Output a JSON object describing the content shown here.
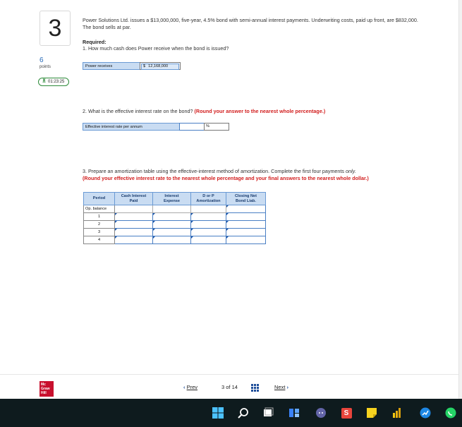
{
  "question": {
    "number": "3",
    "points_value": "6",
    "points_label": "points",
    "timer": "01:23:25",
    "text": "Power Solutions Ltd. issues a $13,000,000, five-year, 4.5% bond with semi-annual interest payments. Underwriting costs, paid up front, are $832,000. The bond sells at par.",
    "required_title": "Required:",
    "required_1": "1. How much cash does Power receive when the bond is issued?"
  },
  "part1": {
    "label": "Power receives",
    "currency": "$",
    "value": "12,168,000"
  },
  "part2": {
    "question": "2. What is the effective interest rate on the bond?",
    "instruction": "(Round your answer to the nearest whole percentage.)",
    "label": "Effective interest rate per annum",
    "value": "",
    "unit": "%"
  },
  "part3": {
    "question_a": "3. Prepare an amortization table using the effective-interest method of amortization. Complete the first four payments ",
    "question_only": "only.",
    "instruction": "(Round your effective interest rate to the nearest whole percentage and your final answers to the nearest whole dollar.)",
    "headers": {
      "period": "Period",
      "cash_interest": [
        "Cash Interest",
        "Paid"
      ],
      "interest_expense": [
        "Interest",
        "Expense"
      ],
      "amortization": [
        "D or P",
        "Amortization"
      ],
      "closing": [
        "Closing Net",
        "Bond Liab."
      ]
    },
    "rows": [
      "Op. balance",
      "1",
      "2",
      "3",
      "4"
    ]
  },
  "footer": {
    "logo_lines": [
      "Mc",
      "Graw",
      "Hill"
    ],
    "prev": "Prev",
    "page_current": "3",
    "page_of": "of",
    "page_total": "14",
    "next": "Next"
  },
  "taskbar": {
    "icons": [
      "windows-start-icon",
      "search-icon",
      "task-view-icon",
      "widgets-icon",
      "teams-chat-icon",
      "app-s-icon",
      "sticky-notes-icon",
      "power-bi-icon",
      "chart-app-icon",
      "whatsapp-icon"
    ]
  }
}
